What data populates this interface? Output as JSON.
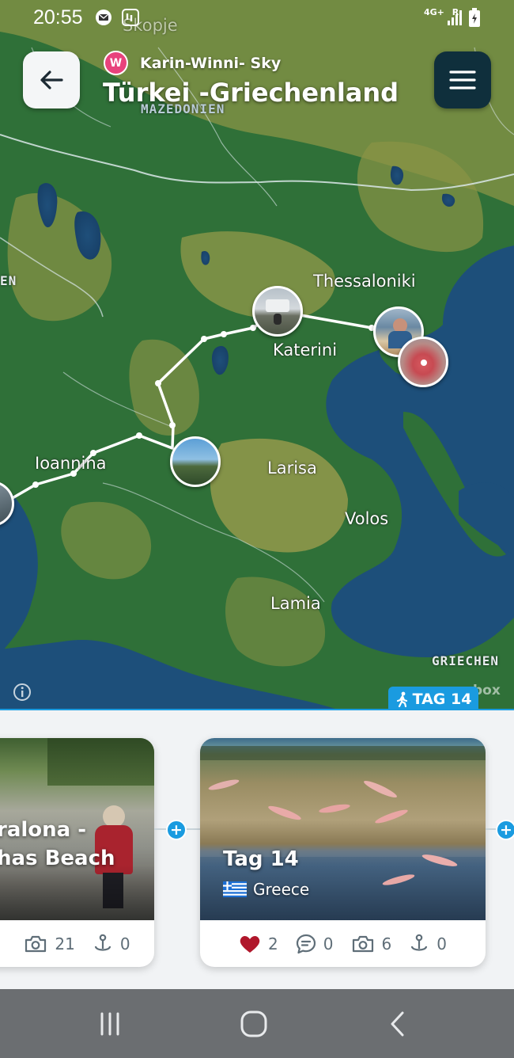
{
  "status_bar": {
    "time": "20:55",
    "network": "4G+",
    "roaming": "R",
    "icons": [
      "mail-icon",
      "voicemail-icon",
      "signal-icon",
      "battery-charging-icon"
    ]
  },
  "header": {
    "author_initial": "W",
    "author_name": "Karin-Winni- Sky",
    "trip_title": "Türkei -Griechenland",
    "back_icon": "arrow-left-icon",
    "menu_icon": "hamburger-menu-icon"
  },
  "map": {
    "cities": [
      "Skopje",
      "Thessaloniki",
      "Katerini",
      "Ioannina",
      "Larisa",
      "Volos",
      "Lamia"
    ],
    "countries": [
      "MAZEDONIEN",
      "EN",
      "GRIECHEN"
    ],
    "attribution": "box",
    "day_badge": "TAG 14",
    "colors": {
      "water": "#1d4f7a",
      "forest": "#2e6f3a",
      "plain": "#8a9446",
      "route": "#ffffff",
      "accent": "#1a9be0"
    }
  },
  "cards": [
    {
      "title_lines": [
        "ralona -",
        "has Beach"
      ],
      "stats": [
        {
          "icon": "camera-icon",
          "value": "21"
        },
        {
          "icon": "footprint-pin-icon",
          "value": "0"
        }
      ]
    },
    {
      "title": "Tag 14",
      "country": "Greece",
      "flag": "greece-flag-icon",
      "stats": [
        {
          "icon": "heart-icon",
          "value": "2"
        },
        {
          "icon": "comment-icon",
          "value": "0"
        },
        {
          "icon": "camera-icon",
          "value": "6"
        },
        {
          "icon": "footprint-pin-icon",
          "value": "0"
        }
      ]
    }
  ],
  "add_button_label": "+",
  "nav_bar": {
    "buttons": [
      "recent-apps-icon",
      "home-icon",
      "back-nav-icon"
    ]
  }
}
